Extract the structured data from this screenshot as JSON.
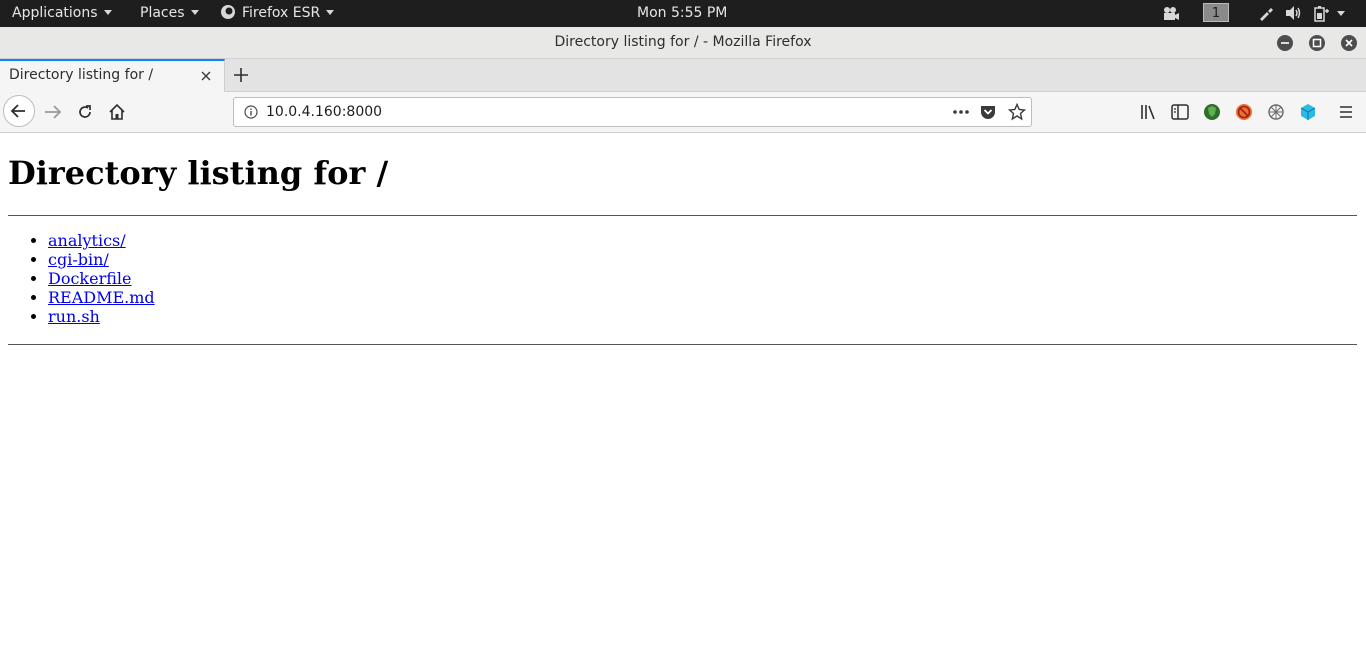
{
  "topbar": {
    "applications": "Applications",
    "places": "Places",
    "app_name": "Firefox ESR",
    "clock": "Mon  5:55 PM",
    "workspace": "1"
  },
  "window": {
    "title": "Directory listing for / - Mozilla Firefox"
  },
  "tabs": [
    {
      "label": "Directory listing for /",
      "active": true
    }
  ],
  "navbar": {
    "url": "10.0.4.160:8000"
  },
  "page": {
    "heading": "Directory listing for /",
    "entries": [
      "analytics/",
      "cgi-bin/",
      "Dockerfile",
      "README.md",
      "run.sh"
    ]
  },
  "colors": {
    "link": "#0000ee",
    "tab_accent": "#0a84ff",
    "topbar_bg": "#1e1e1e"
  },
  "icons": {
    "extension_1": "green-shield-icon",
    "extension_2": "orange-blocked-icon",
    "extension_3": "gray-network-icon",
    "extension_4": "cyan-cube-icon"
  }
}
